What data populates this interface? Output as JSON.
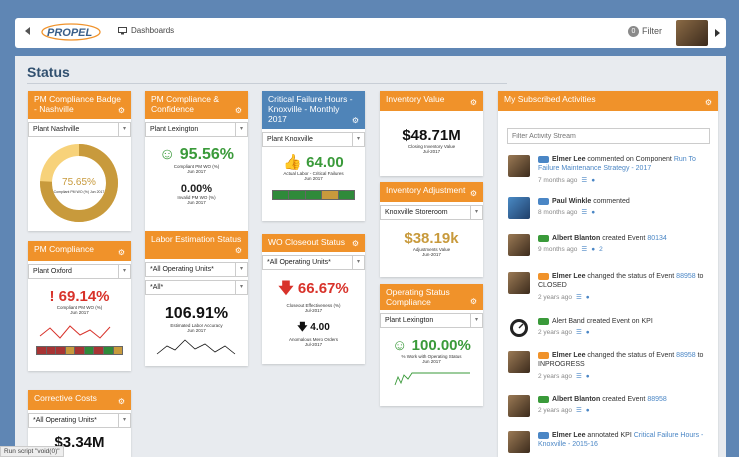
{
  "nav": {
    "dashboards_label": "Dashboards",
    "filter_label": "Filter",
    "filter_count": "0"
  },
  "page": {
    "title": "Status"
  },
  "cards": {
    "pm_badge": {
      "title": "PM Compliance Badge - Nashville",
      "select": "Plant Nashville",
      "value": "75.65%",
      "sub": "Compliant PM WO (%) Jun 2017",
      "progress": 0.7565
    },
    "pm_conf": {
      "title": "PM Compliance & Confidence",
      "select": "Plant Lexington",
      "value": "95.56%",
      "sub1": "Compliant PM WO (%)",
      "sub2": "Jun 2017",
      "value2": "0.00%",
      "sub3": "Invalid PM WO (%)",
      "sub4": "Jun 2017"
    },
    "crit": {
      "title": "Critical Failure Hours - Knoxville - Monthly 2017",
      "select": "Plant Knoxville",
      "value": "64.00",
      "sub1": "Actual Labor - Critical Failures",
      "sub2": "Jun 2017"
    },
    "inv_value": {
      "title": "Inventory Value",
      "value": "$48.71M",
      "sub1": "Closing Inventory Value",
      "sub2": "Jul-2017"
    },
    "inv_adj": {
      "title": "Inventory Adjustment",
      "select": "Knoxville Storeroom",
      "value": "$38.19k",
      "sub1": "Adjustments Value",
      "sub2": "Jun-2017"
    },
    "pm_comp": {
      "title": "PM Compliance",
      "select": "Plant Oxford",
      "value": "69.14%",
      "sub1": "Compliant PM WO (%)",
      "sub2": "Jun 2017"
    },
    "labor": {
      "title": "Labor Estimation Status",
      "select1": "*All Operating Units*",
      "select2": "*All*",
      "value": "106.91%",
      "sub1": "Estimated Labor Accuracy",
      "sub2": "Jun 2017"
    },
    "wo": {
      "title": "WO Closeout Status",
      "select": "*All Operating Units*",
      "value": "66.67%",
      "sub1": "Closeout Effectiveness (%)",
      "sub2": "Jul-2017",
      "value2": "4.00",
      "sub3": "Anomalous Mero Orders",
      "sub4": "Jul-2017"
    },
    "ops": {
      "title": "Operating Status Compliance",
      "select": "Plant Lexington",
      "value": "100.00%",
      "sub1": "% Work with Operating Status",
      "sub2": "Jun 2017"
    },
    "corr": {
      "title": "Corrective Costs",
      "select": "*All Operating Units*",
      "value": "$3.34M"
    }
  },
  "activities": {
    "title": "My Subscribed Activities",
    "filter_placeholder": "Filter Activity Stream",
    "items": [
      {
        "name": "Elmer Lee",
        "text": "commented on Component",
        "link": "Run To Failure Maintenance Strategy - 2017",
        "time": "7 months ago",
        "extra": ""
      },
      {
        "name": "Paul Winkle",
        "text": "commented",
        "link": "",
        "time": "8 months ago",
        "extra": ""
      },
      {
        "name": "Albert Blanton",
        "text": "created Event",
        "link": "80134",
        "time": "9 months ago",
        "extra": "2"
      },
      {
        "name": "Elmer Lee",
        "text": "changed the status of Event",
        "link": "88958",
        "after": "to CLOSED",
        "time": "2 years ago",
        "extra": ""
      },
      {
        "name": "",
        "text": "Alert Band created Event on KPI",
        "link": "",
        "time": "2 years ago",
        "extra": ""
      },
      {
        "name": "Elmer Lee",
        "text": "changed the status of Event",
        "link": "88958",
        "after": "to INPROGRESS",
        "time": "2 years ago",
        "extra": ""
      },
      {
        "name": "Albert Blanton",
        "text": "created Event",
        "link": "88958",
        "time": "2 years ago",
        "extra": ""
      },
      {
        "name": "Elmer Lee",
        "text": "annotated KPI",
        "link": "Critical Failure Hours - Knoxville - 2015-16",
        "time": "",
        "extra": ""
      }
    ]
  },
  "statusbar": {
    "text": "Run script \"void(0)\""
  },
  "colors": {
    "orange": "#f0922a",
    "blue": "#4f84b8",
    "green": "#3a9a3a",
    "red": "#d8322a",
    "gold": "#c89a3c"
  }
}
